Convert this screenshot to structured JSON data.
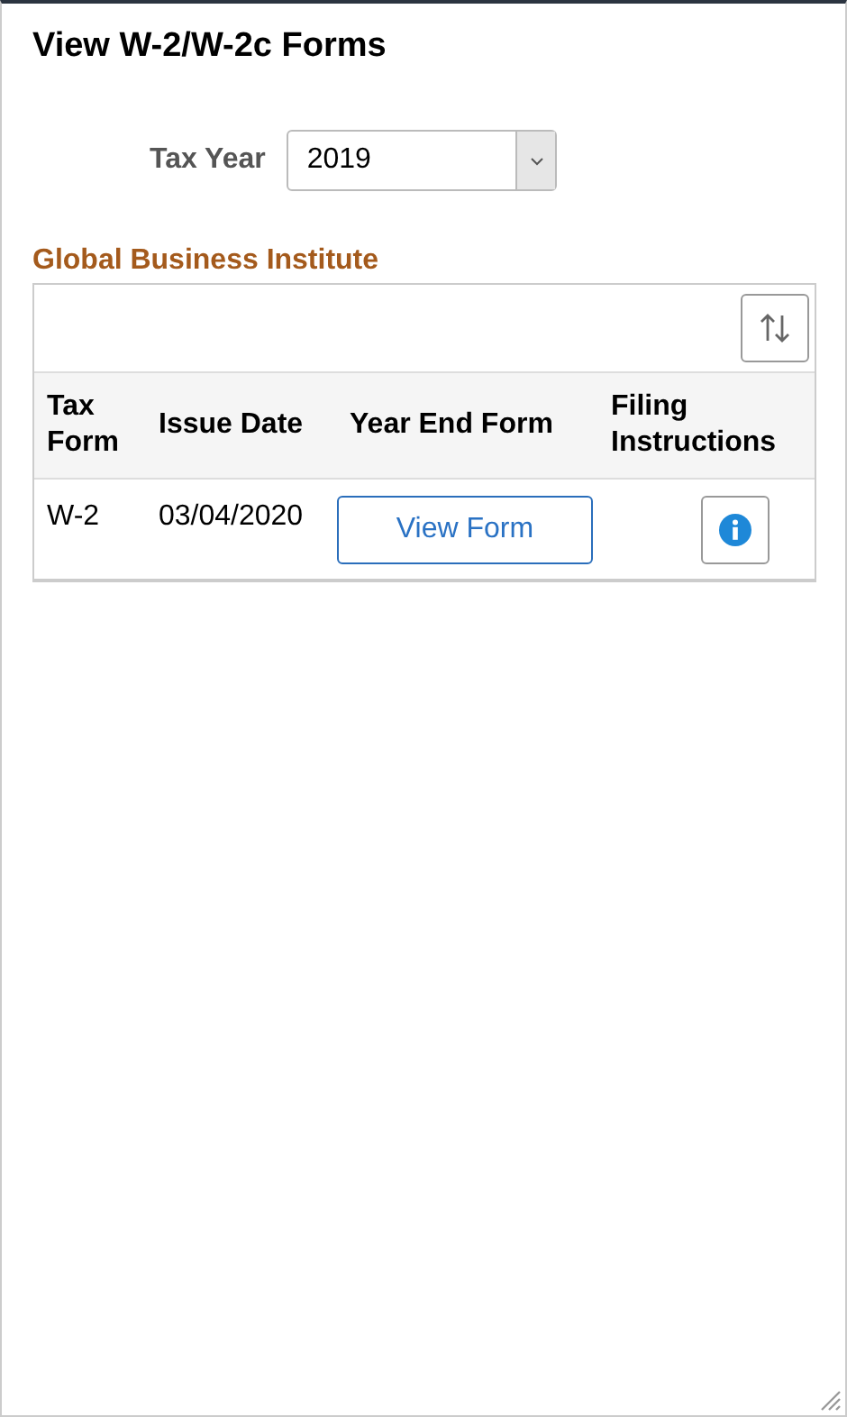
{
  "page_title": "View W-2/W-2c Forms",
  "tax_year": {
    "label": "Tax Year",
    "value": "2019"
  },
  "company": "Global Business Institute",
  "table": {
    "columns": [
      "Tax Form",
      "Issue Date",
      "Year End Form",
      "Filing Instructions"
    ],
    "rows": [
      {
        "tax_form": "W-2",
        "issue_date": "03/04/2020",
        "year_end_button": "View Form"
      }
    ]
  }
}
